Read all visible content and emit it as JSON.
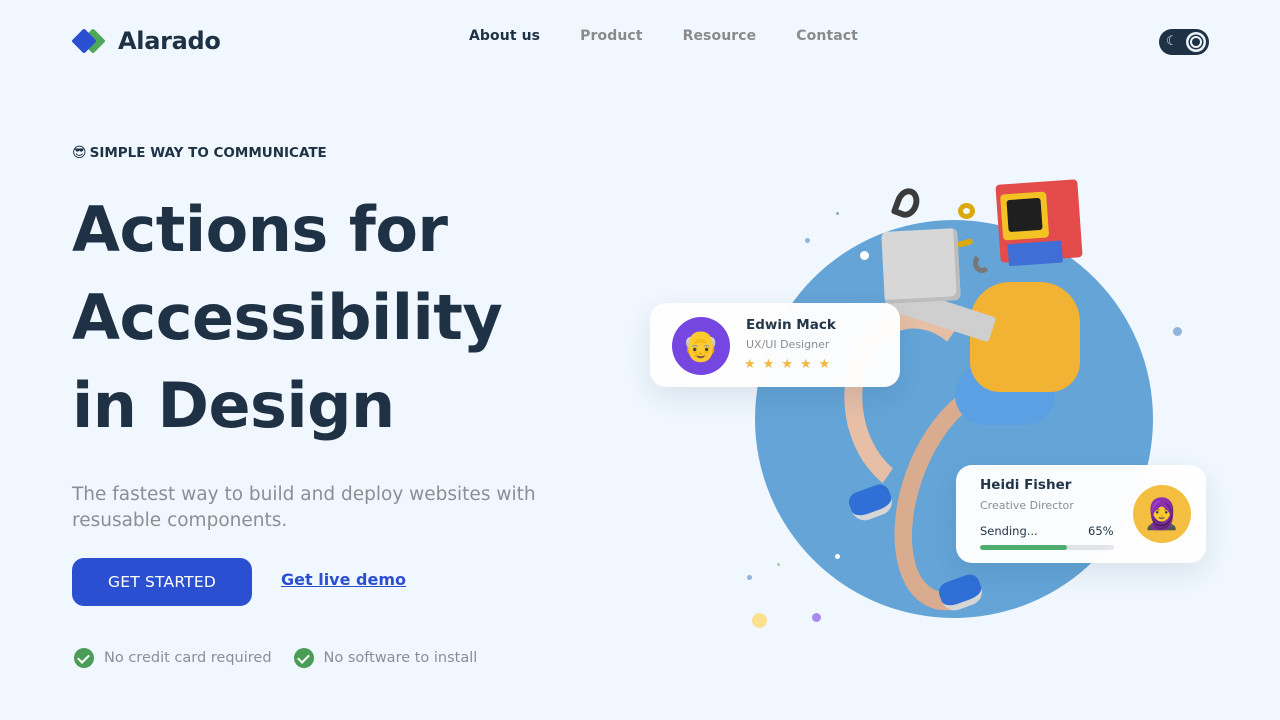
{
  "brand": {
    "name": "Alarado",
    "primary_color": "#2b4fd1",
    "secondary_color": "#4fa85a",
    "text_color": "#1f3144",
    "background": "#f0f7fe"
  },
  "nav": {
    "items": [
      {
        "label": "About us",
        "active": true
      },
      {
        "label": "Product",
        "active": false
      },
      {
        "label": "Resource",
        "active": false
      },
      {
        "label": "Contact",
        "active": false
      }
    ]
  },
  "theme_toggle": {
    "left_icon": "moon-icon",
    "right_icon": "sun-icon",
    "moon_glyph": "☾",
    "mode": "light"
  },
  "hero": {
    "eyebrow_emoji": "😎",
    "eyebrow": "SIMPLE WAY TO COMMUNICATE",
    "title_lines": [
      "Actions for",
      "Accessibility",
      "in Design"
    ],
    "subtitle": "The fastest way to build and deploy websites with resusable components.",
    "cta_label": "GET STARTED",
    "demo_link": "Get live demo",
    "checks": [
      {
        "icon": "check-circle-icon",
        "label": "No credit card required"
      },
      {
        "icon": "check-circle-icon",
        "label": "No software to install"
      }
    ]
  },
  "cards": {
    "edwin": {
      "name": "Edwin Mack",
      "role": "UX/UI Designer",
      "avatar_emoji": "👴",
      "rating": 5,
      "star_glyph": "★"
    },
    "heidi": {
      "name": "Heidi Fisher",
      "role": "Creative Director",
      "avatar_emoji": "🧕",
      "status": "Sending...",
      "progress_label": "65%",
      "progress": 0.65
    }
  }
}
